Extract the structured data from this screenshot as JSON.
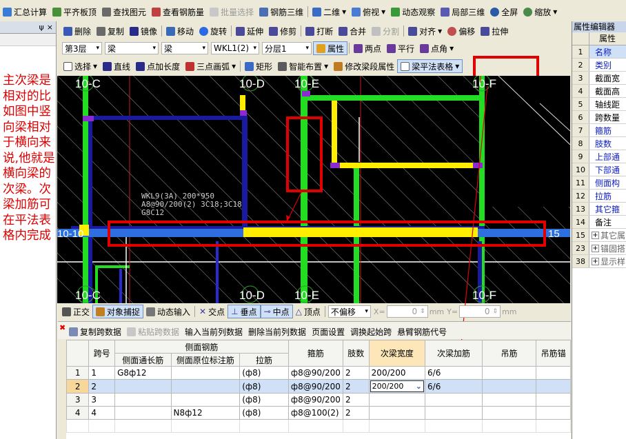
{
  "toolbar1": {
    "items": [
      "汇总计算",
      "平齐板顶",
      "查找图元",
      "查看钢筋量",
      "批量选择",
      "钢筋三维",
      "二维",
      "俯视",
      "动态观察",
      "局部三维",
      "全屏",
      "缩放"
    ]
  },
  "toolbar2": {
    "items": [
      "删除",
      "复制",
      "镜像",
      "移动",
      "旋转",
      "延伸",
      "修剪",
      "打断",
      "合并",
      "分割",
      "对齐",
      "偏移",
      "拉伸"
    ]
  },
  "toolbar3": {
    "floor": "第3层",
    "category": "梁",
    "type": "梁",
    "component": "WKL1(2)",
    "layer": "分层1",
    "properties_btn": "属性",
    "two_point": "两点",
    "parallel": "平行",
    "point_angle": "点角"
  },
  "toolbar4": {
    "items": [
      "选择",
      "直线",
      "点加长度",
      "三点画弧",
      "矩形",
      "智能布置",
      "修改梁段属性",
      "梁平法表格"
    ]
  },
  "snapbar": {
    "items": [
      "正交",
      "对象捕捉",
      "动态输入",
      "交点",
      "垂点",
      "中点",
      "顶点"
    ],
    "offset_mode": "不偏移",
    "x_label": "X=",
    "x_value": "0",
    "y_label": "Y=",
    "y_value": "0",
    "unit": "mm"
  },
  "gridtoolbar": {
    "items": [
      "复制跨数据",
      "粘贴跨数据",
      "输入当前列数据",
      "删除当前列数据",
      "页面设置",
      "调换起始跨",
      "悬臂钢筋代号"
    ]
  },
  "leftpane": {
    "pin": "ψ",
    "close": "×"
  },
  "annotation": "主次梁是相对的比如图中竖向梁相对于横向来说,他就是横向梁的次梁。次梁加筋可在平法表格内完成",
  "canvas": {
    "axis_top": [
      "10-C",
      "10-D",
      "10-E",
      "10-F"
    ],
    "axis_bottom": [
      "10-C",
      "10-D",
      "10-E",
      "10-F"
    ],
    "axis_left": "10-10",
    "axis_right": "15",
    "beam_label": [
      "WKL9(3A) 200*950",
      "A8@90/200(2) 3C18;3C18",
      "G8C12"
    ]
  },
  "properties": {
    "title": "属性编辑器",
    "col_header": "属性",
    "rows": [
      {
        "n": "1",
        "name": "名称",
        "blue": true
      },
      {
        "n": "2",
        "name": "类别",
        "blue": true
      },
      {
        "n": "3",
        "name": "截面宽",
        "blue": false
      },
      {
        "n": "4",
        "name": "截面高",
        "blue": false
      },
      {
        "n": "5",
        "name": "轴线距",
        "blue": false
      },
      {
        "n": "6",
        "name": "跨数量",
        "blue": false
      },
      {
        "n": "7",
        "name": "箍筋",
        "blue": true
      },
      {
        "n": "8",
        "name": "肢数",
        "blue": true
      },
      {
        "n": "9",
        "name": "上部通",
        "blue": true
      },
      {
        "n": "10",
        "name": "下部通",
        "blue": true
      },
      {
        "n": "11",
        "name": "侧面构",
        "blue": true
      },
      {
        "n": "12",
        "name": "拉筋",
        "blue": true
      },
      {
        "n": "13",
        "name": "其它箍",
        "blue": true
      },
      {
        "n": "14",
        "name": "备注",
        "blue": false
      },
      {
        "n": "15",
        "name": "其它属",
        "blue": false
      },
      {
        "n": "23",
        "name": "锚固搭",
        "blue": false
      },
      {
        "n": "38",
        "name": "显示样",
        "blue": false
      }
    ]
  },
  "grid": {
    "group_header": "侧面钢筋",
    "headers": [
      "跨号",
      "侧面通长筋",
      "侧面原位标注筋",
      "拉筋",
      "箍筋",
      "肢数",
      "次梁宽度",
      "次梁加筋",
      "吊筋",
      "吊筋锚"
    ],
    "rows": [
      {
        "idx": "1",
        "span": "1",
        "long": "G8ф12",
        "pos": "",
        "tie": "(ф8)",
        "stir": "ф8@90/200",
        "legs": "2",
        "width": "200/200",
        "add": "6/6"
      },
      {
        "idx": "2",
        "span": "2",
        "long": "",
        "pos": "",
        "tie": "(ф8)",
        "stir": "ф8@90/200",
        "legs": "2",
        "width": "200/200",
        "add": "6/6"
      },
      {
        "idx": "3",
        "span": "3",
        "long": "",
        "pos": "",
        "tie": "(ф8)",
        "stir": "ф8@90/200",
        "legs": "2",
        "width": "",
        "add": ""
      },
      {
        "idx": "4",
        "span": "4",
        "long": "",
        "pos": "N8ф12",
        "tie": "(ф8)",
        "stir": "ф8@100(2)",
        "legs": "2",
        "width": "",
        "add": ""
      }
    ]
  },
  "colors": {
    "highlight_red": "#e00000",
    "beam_green": "#22dd22",
    "beam_yellow": "#ffee00",
    "beam_blue": "#1a1aa0",
    "axis_blue": "#2e6fe0",
    "selected_row": "#cfe0f7"
  }
}
